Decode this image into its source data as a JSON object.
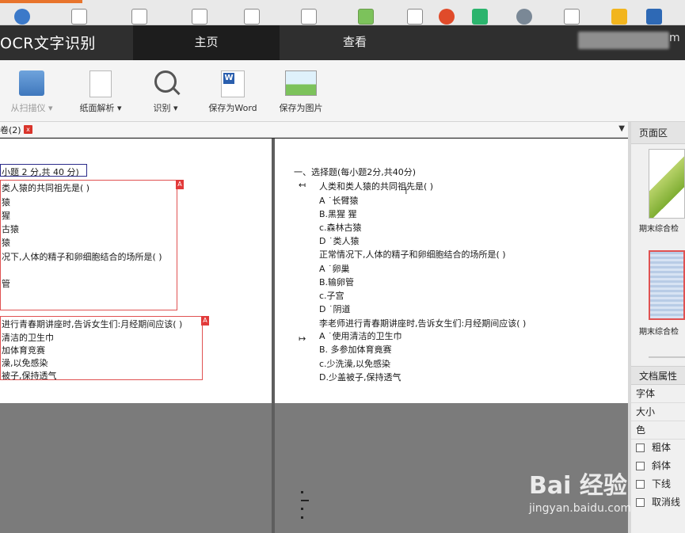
{
  "app": {
    "title": "OCR文字识别",
    "tabs": [
      "主页",
      "查看"
    ],
    "user_suffix": "m"
  },
  "toolbar": {
    "scan": "从扫描仪",
    "parse": "纸面解析",
    "recognize": "识别",
    "save_word": "保存为Word",
    "save_image": "保存为图片"
  },
  "doc_tab": {
    "label": "卷(2)",
    "close": "x"
  },
  "left_pane": {
    "lines": [
      "小题 2 分,共 40 分)",
      "类人猿的共同祖先是(          )",
      "猿",
      "猩",
      "古猿",
      "猿",
      "况下,人体的精子和卵细胞结合的场所是(          )",
      "管",
      "进行青春期讲座时,告诉女生们:月经期间应该(          )",
      "清洁的卫生巾",
      "加体育竞赛",
      "澡,以免感染",
      "被子,保持透气"
    ]
  },
  "right_pane": {
    "lines": [
      "一、选择题(每小题2分,共40分)",
      "人类和类人猿的共同祖先是(          )",
      "A ˙长臂猿",
      "B.黑猩 猩",
      "c.森林古猿",
      "D ˙类人猿",
      "正常情况下,人体的精子和卵细胞结合的场所是(          )",
      "A ˙卵巢",
      "B.输卵管",
      "c.子宫",
      "D ˙阴道",
      "李老师进行青春期讲座时,告诉女生们:月经期间应该(          )",
      "A ˙使用清洁的卫生巾",
      "B. 多参加体育竟赛",
      "c.少洗澡,以免感染",
      "D.少盖被子,保持透气"
    ],
    "markers": [
      "↤",
      "↦"
    ]
  },
  "sidebar": {
    "pages_header": "页面区",
    "thumb_labels": [
      "期末综合检",
      "期末综合检"
    ],
    "props_header": "文档属性",
    "props": [
      "字体",
      "大小",
      "色"
    ],
    "checks": [
      "粗体",
      "斜体",
      "下线",
      "取消线"
    ]
  },
  "watermark": {
    "logo": "Bai  经验",
    "url": "jingyan.baidu.com"
  }
}
